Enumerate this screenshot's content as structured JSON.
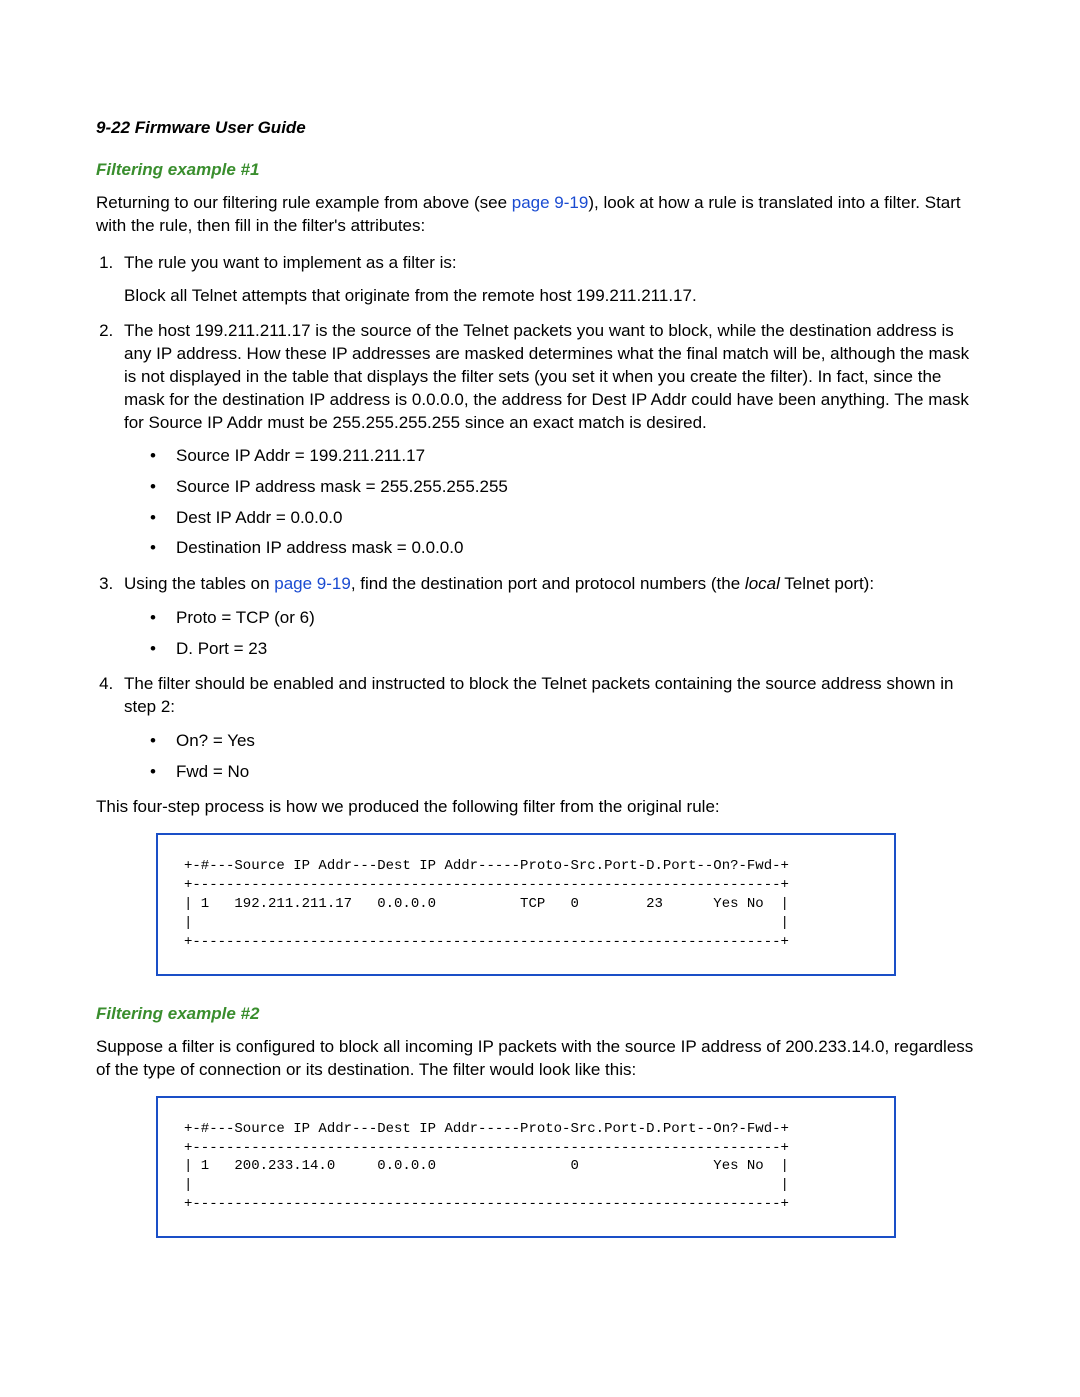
{
  "header": "9-22  Firmware User Guide",
  "section1": {
    "title": "Filtering example #1",
    "intro_before_link": "Returning to our filtering rule example from above (see ",
    "intro_link": "page 9-19",
    "intro_after_link": "), look at how a rule is translated into a filter. Start with the rule, then fill in the filter's attributes:",
    "step1_lead": "The rule you want to implement as a filter is:",
    "step1_body": "Block all Telnet attempts that originate from the remote host 199.211.211.17.",
    "step2_body": "The host 199.211.211.17 is the source of the Telnet packets you want to block, while the destination address is any IP address. How these IP addresses are masked determines what the final match will be, although the mask is not displayed in the table that displays the filter sets (you set it when you create the filter). In fact, since the mask for the destination IP address is 0.0.0.0, the address for Dest IP Addr could have been anything. The mask for Source IP Addr must be 255.255.255.255 since an exact match is desired.",
    "step2_bullets": [
      "Source IP Addr = 199.211.211.17",
      "Source IP address mask = 255.255.255.255",
      "Dest IP Addr = 0.0.0.0",
      "Destination IP address mask = 0.0.0.0"
    ],
    "step3_before_link": "Using the tables on ",
    "step3_link": "page 9-19",
    "step3_after_link_before_italic": ", find the destination port and protocol numbers (the ",
    "step3_italic": "local",
    "step3_after_italic": " Telnet port):",
    "step3_bullets": [
      "Proto = TCP (or 6)",
      "D. Port = 23"
    ],
    "step4_body": "The filter should be enabled and instructed to block the Telnet packets containing the source address shown in step 2:",
    "step4_bullets": [
      "On? = Yes",
      "Fwd = No"
    ],
    "closing": "This four-step process is how we produced the following filter from the original rule:",
    "code": "+-#---Source IP Addr---Dest IP Addr-----Proto-Src.Port-D.Port--On?-Fwd-+\n+----------------------------------------------------------------------+\n| 1   192.211.211.17   0.0.0.0          TCP   0        23      Yes No  |\n|                                                                      |\n+----------------------------------------------------------------------+"
  },
  "section2": {
    "title": "Filtering example #2",
    "intro": "Suppose a filter is configured to block all incoming IP packets with the source IP address of 200.233.14.0, regardless of the type of connection or its destination. The filter would look like this:",
    "code": "+-#---Source IP Addr---Dest IP Addr-----Proto-Src.Port-D.Port--On?-Fwd-+\n+----------------------------------------------------------------------+\n| 1   200.233.14.0     0.0.0.0                0                Yes No  |\n|                                                                      |\n+----------------------------------------------------------------------+"
  }
}
